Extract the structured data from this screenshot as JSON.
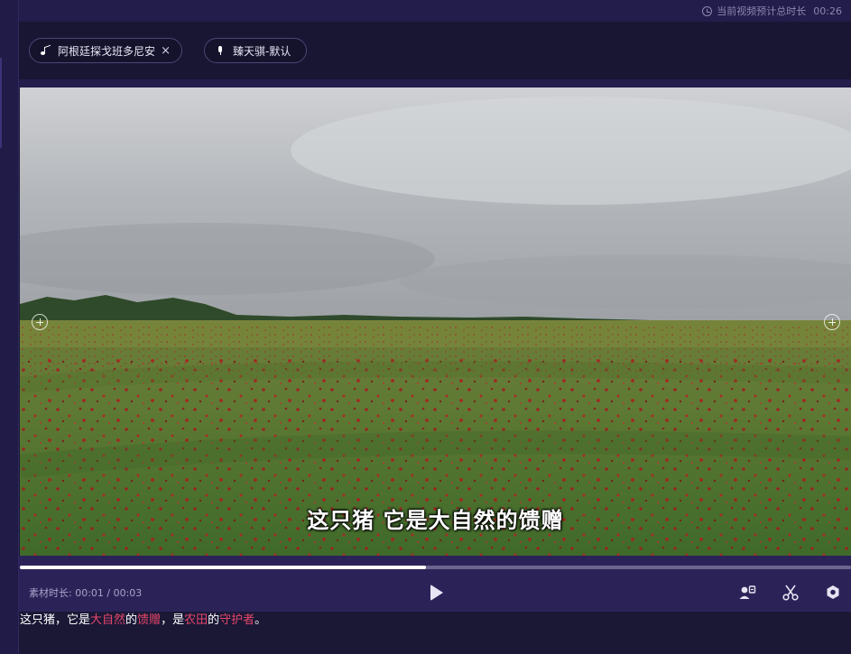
{
  "topbar": {
    "duration_label": "当前视频预计总时长",
    "duration_value": "00:26"
  },
  "chips": {
    "music": {
      "label": "阿根廷探戈班多尼安",
      "icon": "music-note-icon",
      "close": "×"
    },
    "voice": {
      "label": "臻天骐-默认",
      "icon": "microphone-icon"
    }
  },
  "video": {
    "subtitle": "这只猪 它是大自然的馈赠",
    "progress": 0.489
  },
  "controls": {
    "time_label": "素材时长: 00:01 / 00:03"
  },
  "caption": {
    "segments": [
      {
        "text": "这只猪，它是",
        "highlight": false
      },
      {
        "text": "大自然",
        "highlight": true
      },
      {
        "text": "的",
        "highlight": false
      },
      {
        "text": "馈赠",
        "highlight": true
      },
      {
        "text": "，是",
        "highlight": false
      },
      {
        "text": "农田",
        "highlight": true
      },
      {
        "text": "的",
        "highlight": false
      },
      {
        "text": "守护者",
        "highlight": true
      },
      {
        "text": "。",
        "highlight": false
      }
    ]
  },
  "colors": {
    "highlight": "#e5466a",
    "background": "#1b1836",
    "control_bar": "#2b2358"
  }
}
